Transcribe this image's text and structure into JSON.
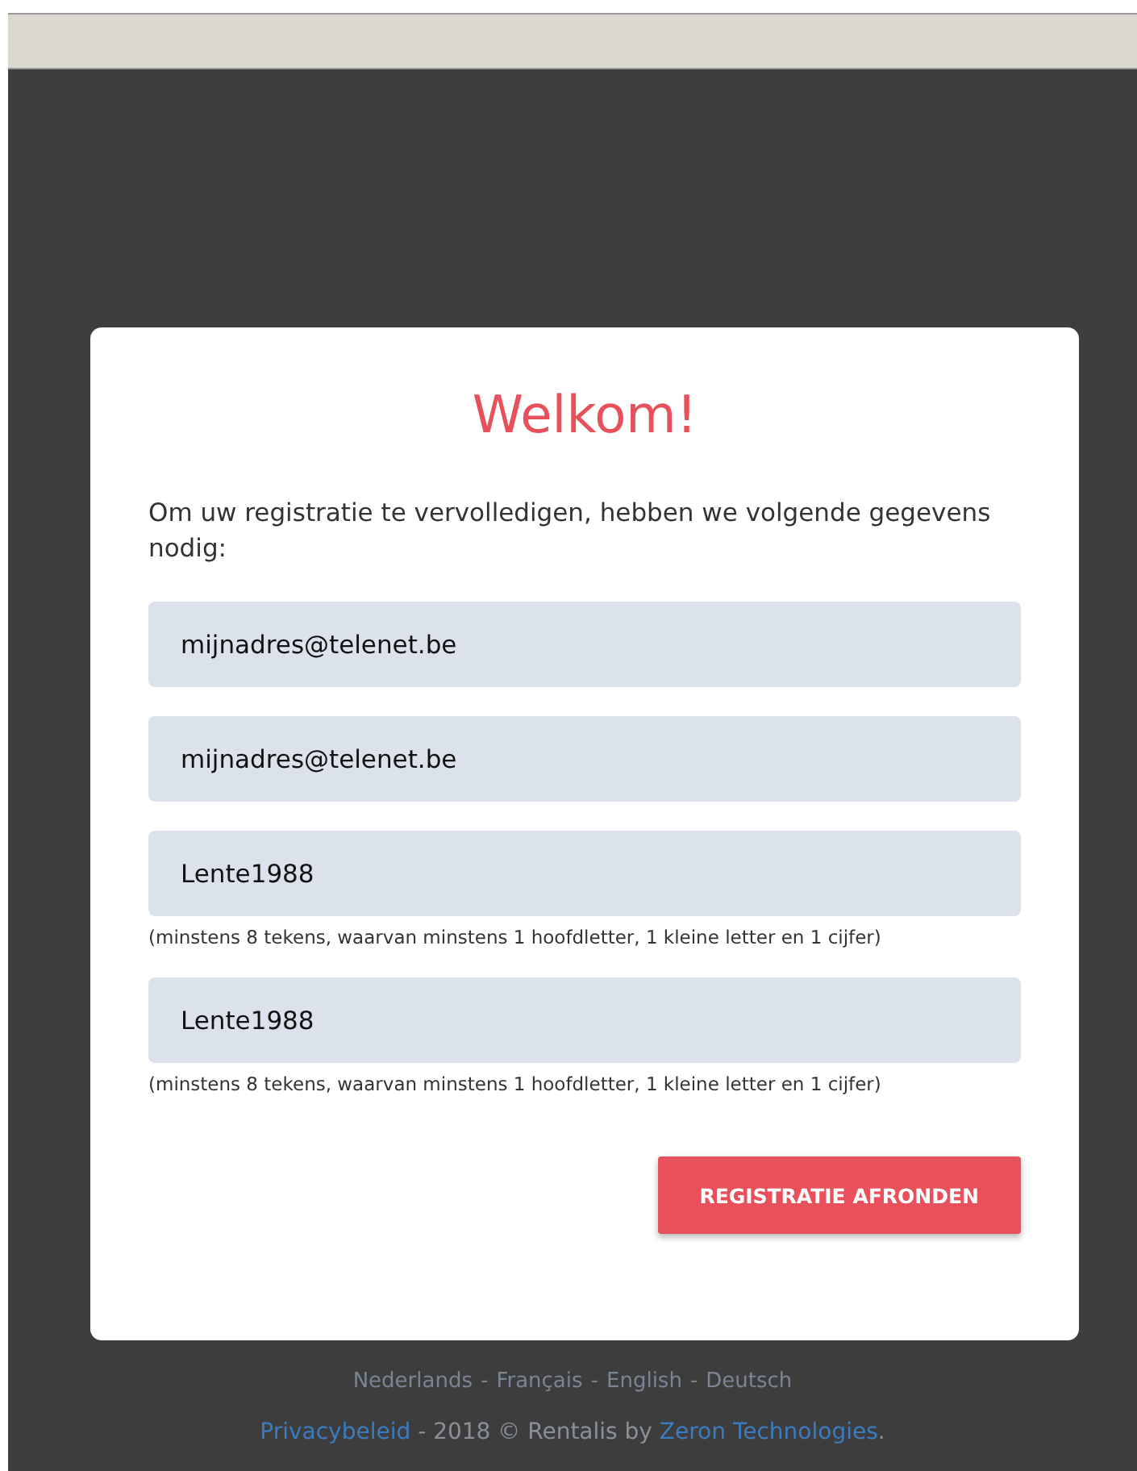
{
  "title": "Welkom!",
  "intro": "Om uw registratie te vervolledigen, hebben we volgende gegevens nodig:",
  "fields": [
    {
      "value": "mijnadres@telenet.be"
    },
    {
      "value": "mijnadres@telenet.be"
    },
    {
      "value": "Lente1988",
      "hint": "(minstens 8 tekens, waarvan minstens 1 hoofdletter, 1 kleine letter en 1 cijfer)"
    },
    {
      "value": "Lente1988",
      "hint": "(minstens 8 tekens, waarvan minstens 1 hoofdletter, 1 kleine letter en 1 cijfer)"
    }
  ],
  "submit_button": "REGISTRATIE AFRONDEN",
  "languages": [
    "Nederlands",
    "Français",
    "English",
    "Deutsch"
  ],
  "language_separator": "-",
  "footer": [
    {
      "kind": "link",
      "text": "Privacybeleid"
    },
    {
      "kind": "text",
      "text": " - 2018 © Rentalis by "
    },
    {
      "kind": "link",
      "text": "Zeron Technologies"
    },
    {
      "kind": "text",
      "text": "."
    }
  ]
}
